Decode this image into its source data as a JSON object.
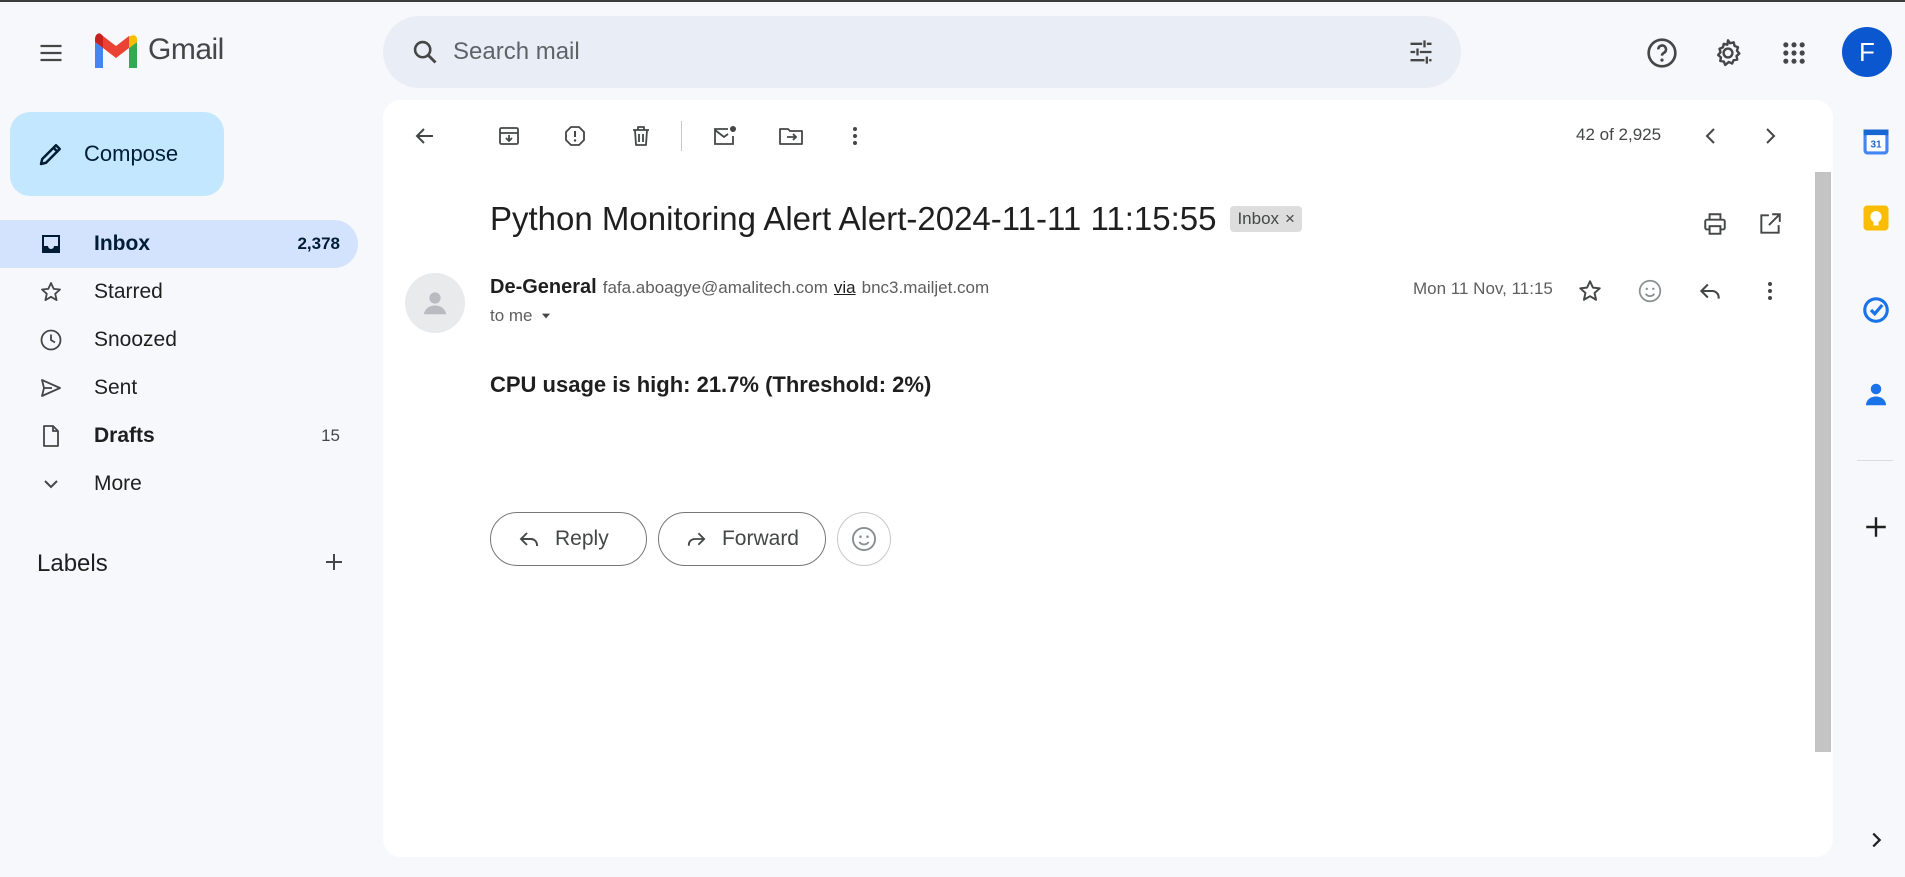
{
  "header": {
    "app_name": "Gmail",
    "search_placeholder": "Search mail",
    "avatar_initial": "F"
  },
  "compose": {
    "label": "Compose"
  },
  "nav": {
    "inbox": {
      "label": "Inbox",
      "count": "2,378"
    },
    "starred": {
      "label": "Starred"
    },
    "snoozed": {
      "label": "Snoozed"
    },
    "sent": {
      "label": "Sent"
    },
    "drafts": {
      "label": "Drafts",
      "count": "15"
    },
    "more": {
      "label": "More"
    }
  },
  "labels": {
    "title": "Labels"
  },
  "toolbar": {
    "pager": "42 of 2,925"
  },
  "email": {
    "subject": "Python Monitoring Alert Alert-2024-11-11 11:15:55",
    "chip_label": "Inbox",
    "chip_close": "×",
    "sender_name": "De-General",
    "sender_email": "fafa.aboagye@amalitech.com",
    "via_label": "via",
    "via_host": "bnc3.mailjet.com",
    "recipient": "to me",
    "date": "Mon 11 Nov, 11:15",
    "body": "CPU usage is high: 21.7% (Threshold: 2%)"
  },
  "actions": {
    "reply_label": "Reply",
    "forward_label": "Forward"
  },
  "colors": {
    "accent": "#0b57d0",
    "compose_bg": "#c2e7ff",
    "active_nav": "#d3e3fd",
    "page_bg": "#f6f8fc"
  }
}
